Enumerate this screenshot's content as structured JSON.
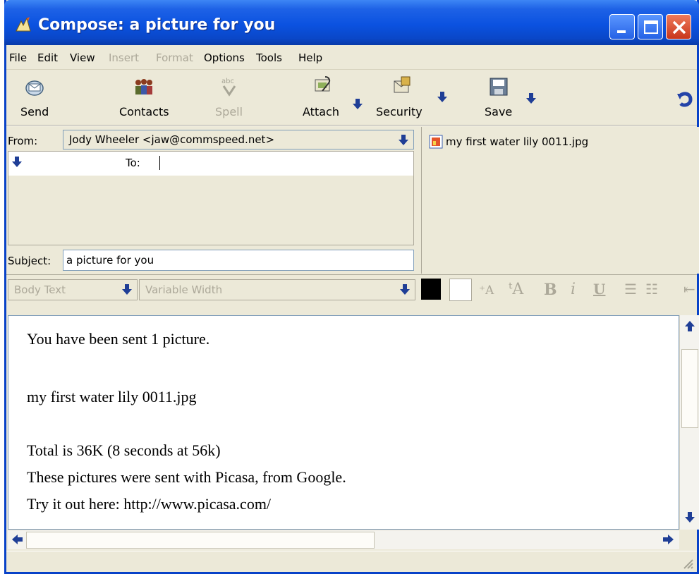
{
  "window": {
    "title": "Compose: a picture for you"
  },
  "menu": [
    {
      "label": "File",
      "enabled": true
    },
    {
      "label": "Edit",
      "enabled": true
    },
    {
      "label": "View",
      "enabled": true
    },
    {
      "label": "Insert",
      "enabled": false
    },
    {
      "label": "Format",
      "enabled": false
    },
    {
      "label": "Options",
      "enabled": true
    },
    {
      "label": "Tools",
      "enabled": true
    },
    {
      "label": "Help",
      "enabled": true
    }
  ],
  "toolbar": {
    "send": "Send",
    "contacts": "Contacts",
    "spell": "Spell",
    "attach": "Attach",
    "security": "Security",
    "save": "Save"
  },
  "header": {
    "from_label": "From:",
    "from_value": "Jody Wheeler <jaw@commspeed.net>",
    "to_label": "To:",
    "to_value": "",
    "subject_label": "Subject:",
    "subject_value": "a picture for you"
  },
  "attachments": [
    {
      "name": "my first water lily 0011.jpg",
      "icon": "image-file-icon"
    }
  ],
  "format": {
    "paragraph_style": "Body Text",
    "font": "Variable Width",
    "text_color": "#000000",
    "background_color": "#ffffff"
  },
  "body": {
    "lines": [
      "You have been sent 1 picture.",
      "",
      "my first water lily 0011.jpg",
      "",
      "Total is 36K (8 seconds at 56k)",
      "These pictures were sent with Picasa, from Google.",
      "Try it out here: http://www.picasa.com/"
    ]
  }
}
